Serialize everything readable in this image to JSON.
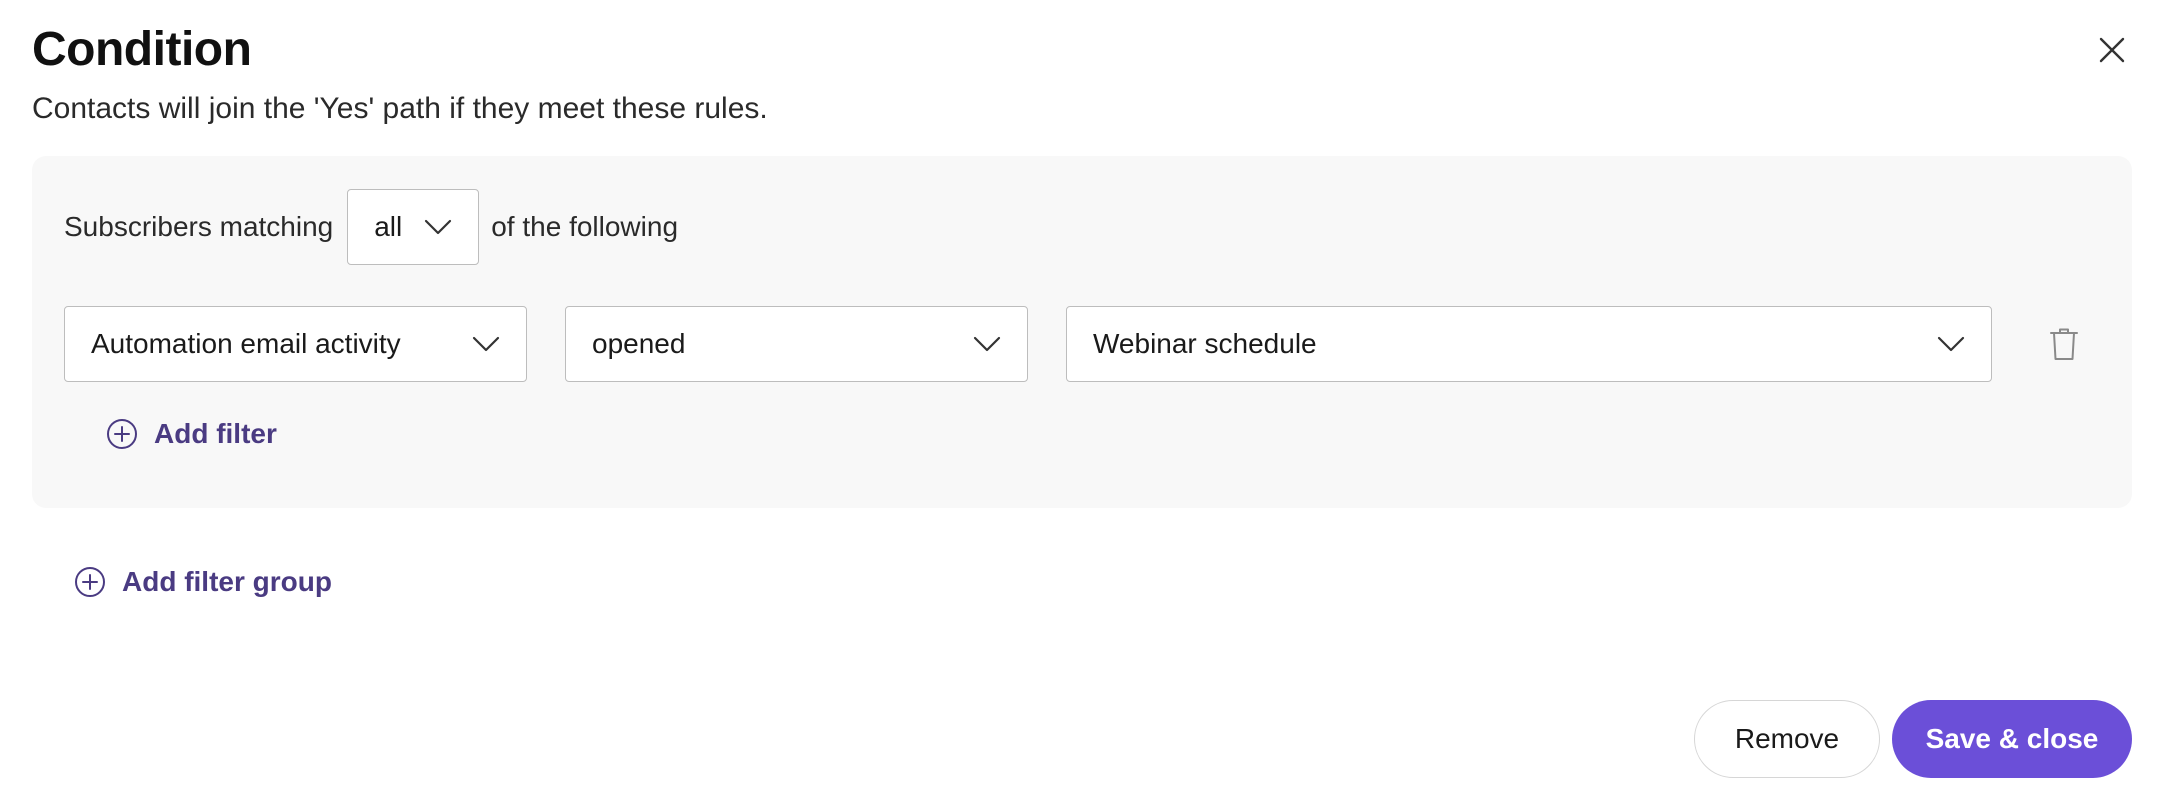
{
  "dialog": {
    "title": "Condition",
    "subtitle": "Contacts will join the 'Yes' path if they meet these rules."
  },
  "icons": {
    "close": "close-icon",
    "chevron": "chevron-down-icon",
    "trash": "trash-icon",
    "add": "plus-circle-icon"
  },
  "group": {
    "prefix": "Subscribers matching",
    "match_value": "all",
    "suffix": "of the following",
    "filters": [
      {
        "field": "Automation email activity",
        "operator": "opened",
        "value": "Webinar schedule"
      }
    ],
    "add_filter_label": "Add filter"
  },
  "add_filter_group_label": "Add filter group",
  "footer": {
    "remove_label": "Remove",
    "save_label": "Save & close"
  },
  "colors": {
    "accent": "#6b4fd8",
    "link": "#4a3b82",
    "panel_bg": "#f8f8f8",
    "border": "#bdbdbd"
  }
}
